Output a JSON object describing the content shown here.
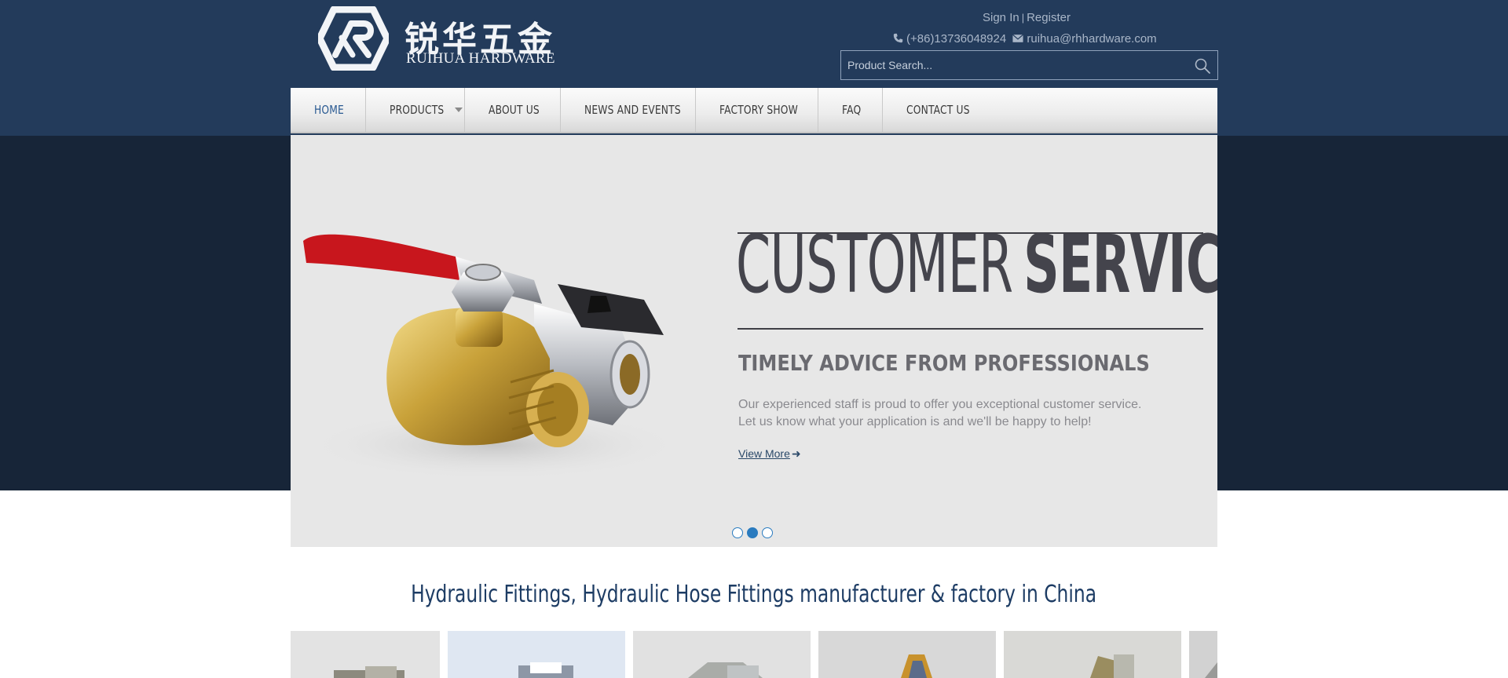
{
  "brand": {
    "name_cn": "锐华五金",
    "name_en": "RUIHUA HARDWARE"
  },
  "header": {
    "sign_in": "Sign In",
    "separator": "|",
    "register": "Register",
    "phone": "(+86)13736048924",
    "email": "ruihua@rhhardware.com",
    "search_placeholder": "Product Search..."
  },
  "nav": {
    "items": [
      {
        "label": "HOME",
        "active": true
      },
      {
        "label": "PRODUCTS",
        "has_dropdown": true
      },
      {
        "label": "ABOUT US"
      },
      {
        "label": "NEWS AND EVENTS"
      },
      {
        "label": "FACTORY SHOW"
      },
      {
        "label": "FAQ"
      },
      {
        "label": "CONTACT US"
      }
    ]
  },
  "hero": {
    "title_light": "CUSTOMER",
    "title_bold": "SERVICE",
    "subtitle": "TIMELY ADVICE FROM PROFESSIONALS",
    "line1": "Our experienced staff is proud to offer you exceptional customer service.",
    "line2": "Let us know what your application is and we'll be happy to help!",
    "view_more": "View More",
    "slides": 3,
    "active_slide": 2
  },
  "section": {
    "title": "Hydraulic Fittings, Hydraulic Hose Fittings manufacturer & factory in China"
  },
  "colors": {
    "header_bg": "#233b5b",
    "dark_band": "#172538",
    "accent": "#2a7bbf",
    "title_text": "#1d3c64"
  }
}
